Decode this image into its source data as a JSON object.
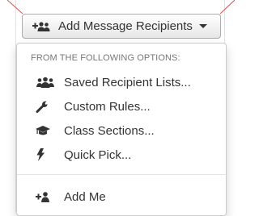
{
  "toggle": {
    "label": "Add Message Recipients",
    "icon": "add-users-icon"
  },
  "menu": {
    "header": "FROM THE FOLLOWING OPTIONS:",
    "items": [
      {
        "label": "Saved Recipient Lists...",
        "icon": "users-icon"
      },
      {
        "label": "Custom Rules...",
        "icon": "wrench-icon"
      },
      {
        "label": "Class Sections...",
        "icon": "graduation-cap-icon"
      },
      {
        "label": "Quick Pick...",
        "icon": "bolt-icon"
      },
      {
        "label": "Add Me",
        "icon": "add-user-icon"
      }
    ]
  },
  "colors": {
    "text": "#333333",
    "header": "#777777",
    "border": "#cccccc",
    "annotation": "#d9534f"
  }
}
